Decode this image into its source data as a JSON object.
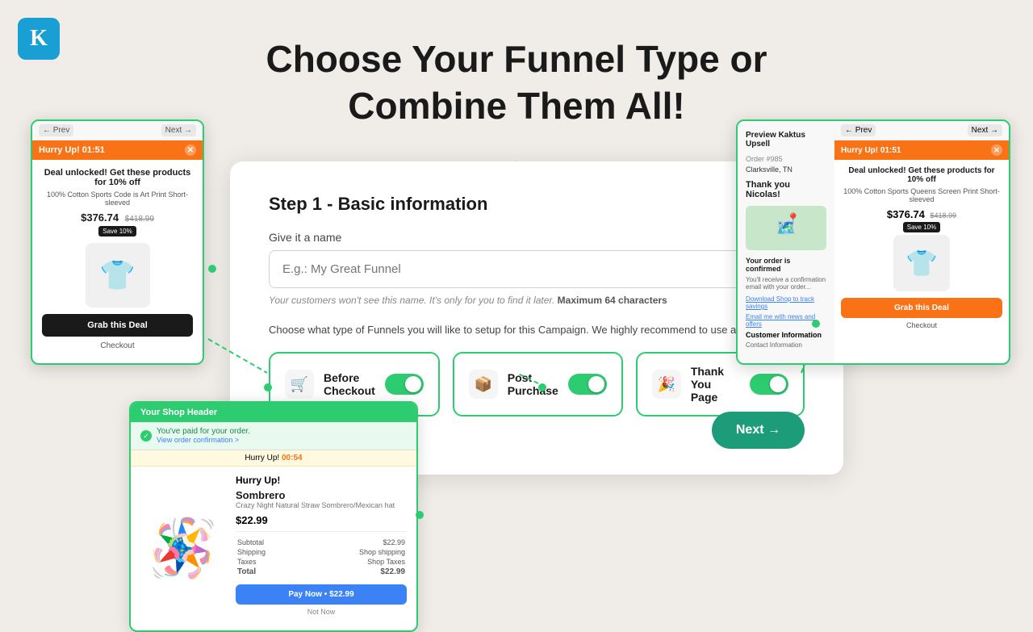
{
  "logo": {
    "letter": "K"
  },
  "heading": {
    "line1": "Choose Your Funnel Type or",
    "line2": "Combine Them All!"
  },
  "central_card": {
    "step_title": "Step 1 - Basic information",
    "field_label": "Give it a name",
    "input_placeholder": "E.g.: My Great Funnel",
    "input_hint": "Your customers won't see this name. It's only for you to find it later.",
    "input_hint_bold": "Maximum 64 characters",
    "choose_text": "Choose what type of Funnels you will like to setup for this Campaign. We highly recommend to use all of them.",
    "next_btn_label": "Next →",
    "funnel_types": [
      {
        "label": "Before Checkout",
        "icon": "🛒",
        "enabled": true
      },
      {
        "label": "Post Purchase",
        "icon": "📦",
        "enabled": true
      },
      {
        "label": "Thank You Page",
        "icon": "🎉",
        "enabled": true
      }
    ]
  },
  "popup_before_checkout": {
    "prev_label": "← Prev",
    "next_label": "Next →",
    "banner_text": "Hurry Up!  01:51",
    "close_x": "✕",
    "deal_title": "Deal unlocked! Get these products for 10% off",
    "product_name": "100% Cotton Sports Code is Art Print Short-sleeved",
    "price": "$376.74",
    "old_price": "$418.99",
    "save_badge": "Save 10%",
    "grab_btn": "Grab this Deal",
    "checkout_link": "Checkout"
  },
  "popup_kaktus": {
    "preview_header": "Preview Kaktus Upsell",
    "preview_label_order": "Order #985",
    "preview_label_clarksville": "Clarksville, TN",
    "thank_name": "Thank you Nicolas!",
    "confirmed_title": "Your order is confirmed",
    "confirmed_sub": "You'll receive a confirmation email with your order...",
    "track_link": "Download Shop to track savings",
    "opt_link": "Email me with news and offers",
    "customer_info": "Customer Information",
    "contact_info": "Contact Information",
    "prev_label": "← Prev",
    "next_label": "Next →",
    "banner_text": "Hurry Up!  01:51",
    "close_x": "✕",
    "deal_title": "Deal unlocked! Get these products for 10% off",
    "product_name": "100% Cotton Sports Queens Screen Print Short-sleeved",
    "price": "$376.74",
    "old_price": "$418.99",
    "save_badge": "Save 10%",
    "grab_btn": "Grab this Deal",
    "checkout_link": "Checkout"
  },
  "popup_thankyou": {
    "shop_header": "Your Shop Header",
    "confirm_text": "You've paid for your order.",
    "view_order": "View order confirmation >",
    "timer_hurry": "Hurry Up!",
    "timer_text": "00:54",
    "hurry_label": "Hurry Up!",
    "product_name": "Sombrero",
    "product_sub": "Crazy Night Natural Straw Sombrero/Mexican hat",
    "price": "$22.99",
    "subtotal_label": "Subtotal",
    "subtotal_val": "$22.99",
    "shipping_label": "Shipping",
    "shipping_val": "Shop shipping",
    "taxes_label": "Taxes",
    "taxes_val": "Shop Taxes",
    "total_label": "Total",
    "total_val": "$22.99",
    "pay_btn": "Pay Now • $22.99",
    "not_now": "Not Now"
  }
}
